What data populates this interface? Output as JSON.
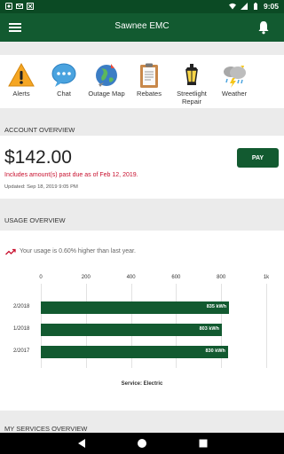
{
  "status_bar": {
    "time": "9:05"
  },
  "app_bar": {
    "title": "Sawnee EMC"
  },
  "quick_actions": [
    {
      "label": "Alerts",
      "icon": "alert-icon"
    },
    {
      "label": "Chat",
      "icon": "chat-icon"
    },
    {
      "label": "Outage Map",
      "icon": "globe-icon"
    },
    {
      "label": "Rebates",
      "icon": "clipboard-icon"
    },
    {
      "label": "Streetlight Repair",
      "icon": "lantern-icon"
    },
    {
      "label": "Weather",
      "icon": "weather-icon"
    }
  ],
  "account": {
    "header": "ACCOUNT OVERVIEW",
    "amount": "$142.00",
    "pay_label": "PAY",
    "past_due": "Includes amount(s) past due as of Feb 12, 2019.",
    "updated": "Updated: Sep 18, 2019 9:05 PM"
  },
  "usage": {
    "header": "USAGE OVERVIEW",
    "note": "Your usage is 0.60% higher than last year.",
    "caption": "Service: Electric"
  },
  "chart_data": {
    "type": "bar",
    "orientation": "horizontal",
    "categories": [
      "2/2018",
      "1/2018",
      "2/2017"
    ],
    "values": [
      835,
      803,
      830
    ],
    "value_labels": [
      "835 kWh",
      "803 kWh",
      "830 kWh"
    ],
    "xticks": [
      "0",
      "200",
      "400",
      "600",
      "800",
      "1k"
    ],
    "xlim": [
      0,
      1000
    ],
    "grid": true,
    "color": "#125a30"
  },
  "services": {
    "header": "MY SERVICES OVERVIEW"
  },
  "colors": {
    "brand_green": "#125a30",
    "status_green": "#0b4a24",
    "alert_red": "#c8102e"
  }
}
